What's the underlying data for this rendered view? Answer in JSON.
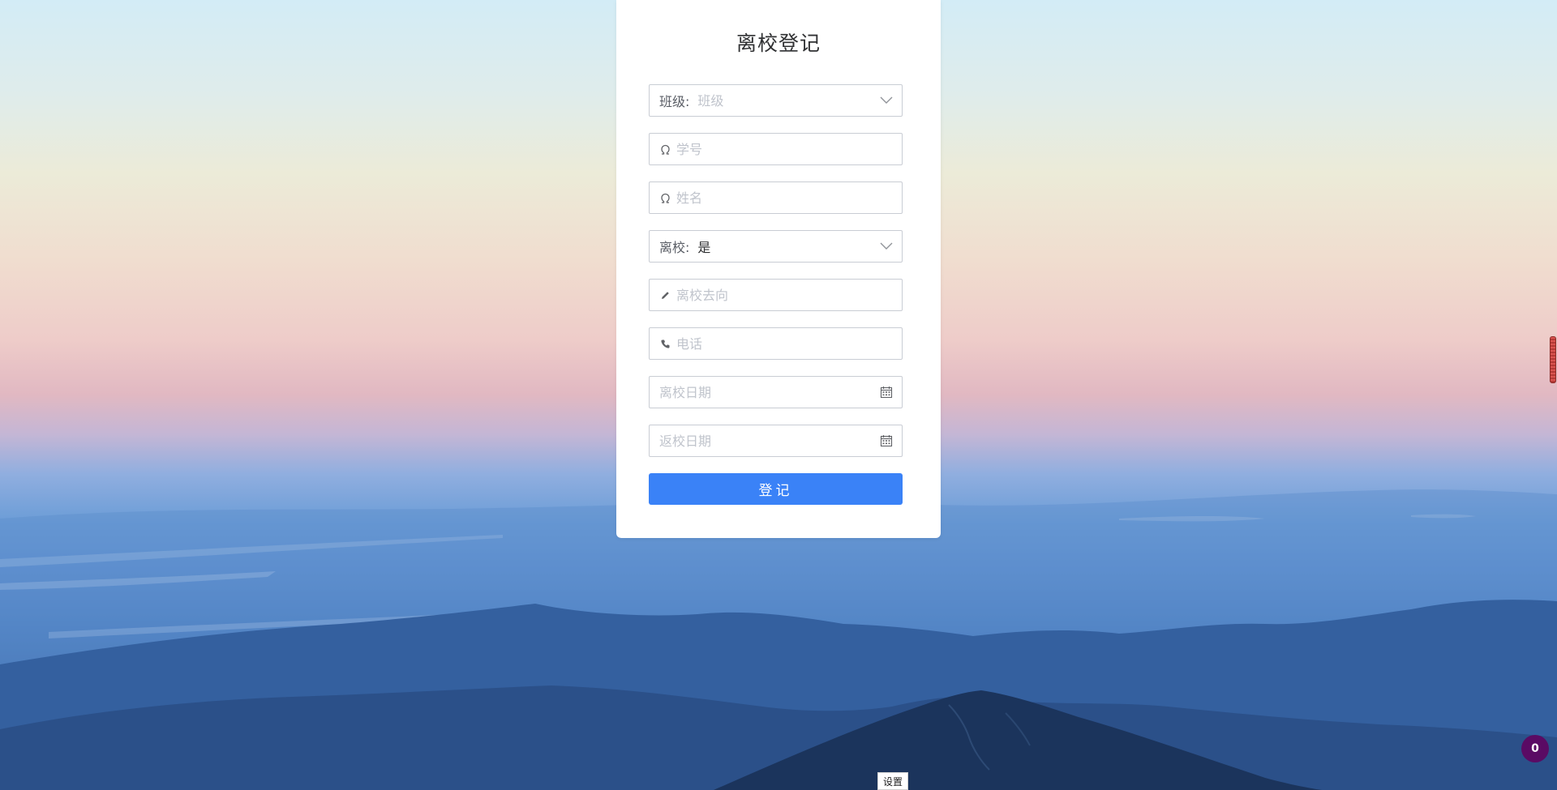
{
  "form": {
    "title": "离校登记",
    "class_field": {
      "label": "班级:",
      "placeholder": "班级",
      "icon": "chevron-down-icon"
    },
    "student_id_field": {
      "placeholder": "学号",
      "icon": "user-icon"
    },
    "name_field": {
      "placeholder": "姓名",
      "icon": "user-icon"
    },
    "leave_field": {
      "label": "离校:",
      "value": "是",
      "icon": "chevron-down-icon"
    },
    "destination_field": {
      "placeholder": "离校去向",
      "icon": "pencil-icon"
    },
    "phone_field": {
      "placeholder": "电话",
      "icon": "phone-icon"
    },
    "leave_date_field": {
      "placeholder": "离校日期",
      "icon": "calendar-icon"
    },
    "return_date_field": {
      "placeholder": "返校日期",
      "icon": "calendar-icon"
    },
    "submit_label": "登记",
    "accent_color": "#3a82f7"
  },
  "settings_button": {
    "label": "设置"
  },
  "notification_badge": {
    "count": "0",
    "color": "#5a0b64"
  }
}
